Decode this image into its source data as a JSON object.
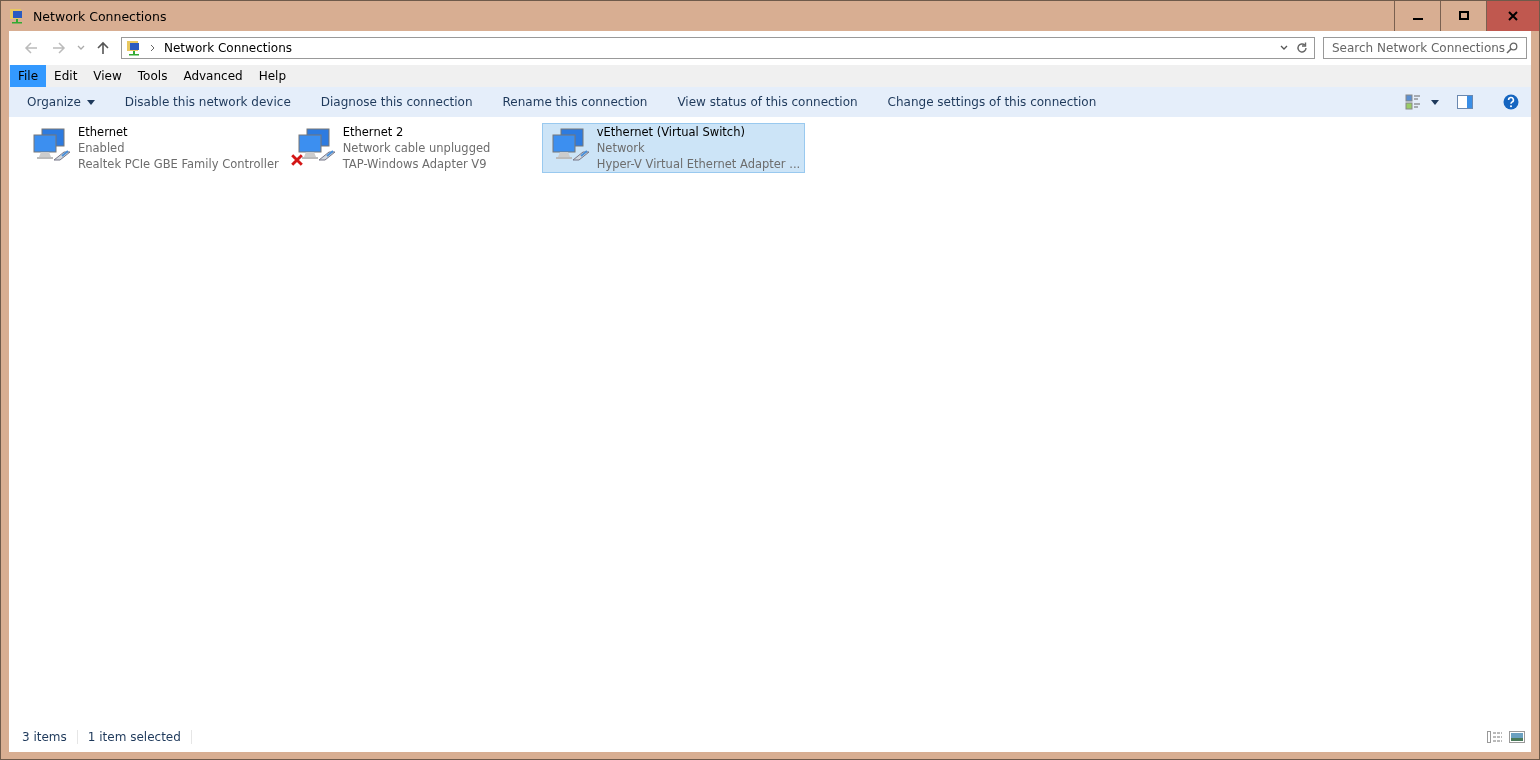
{
  "window": {
    "title": "Network Connections"
  },
  "address": {
    "path": "Network Connections"
  },
  "search": {
    "placeholder": "Search Network Connections"
  },
  "menu": [
    {
      "label": "File",
      "selected": true
    },
    {
      "label": "Edit",
      "selected": false
    },
    {
      "label": "View",
      "selected": false
    },
    {
      "label": "Tools",
      "selected": false
    },
    {
      "label": "Advanced",
      "selected": false
    },
    {
      "label": "Help",
      "selected": false
    }
  ],
  "commands": [
    {
      "label": "Organize",
      "dropdown": true
    },
    {
      "label": "Disable this network device",
      "dropdown": false
    },
    {
      "label": "Diagnose this connection",
      "dropdown": false
    },
    {
      "label": "Rename this connection",
      "dropdown": false
    },
    {
      "label": "View status of this connection",
      "dropdown": false
    },
    {
      "label": "Change settings of this connection",
      "dropdown": false
    }
  ],
  "connections": [
    {
      "name": "Ethernet",
      "status": "Enabled",
      "adapter": "Realtek PCIe GBE Family Controller",
      "unplugged": false,
      "selected": false
    },
    {
      "name": "Ethernet 2",
      "status": "Network cable unplugged",
      "adapter": "TAP-Windows Adapter V9",
      "unplugged": true,
      "selected": false
    },
    {
      "name": "vEthernet (Virtual Switch)",
      "status": "Network",
      "adapter": "Hyper-V Virtual Ethernet Adapter ...",
      "unplugged": false,
      "selected": true
    }
  ],
  "status_bar": {
    "count": "3 items",
    "selection": "1 item selected"
  }
}
